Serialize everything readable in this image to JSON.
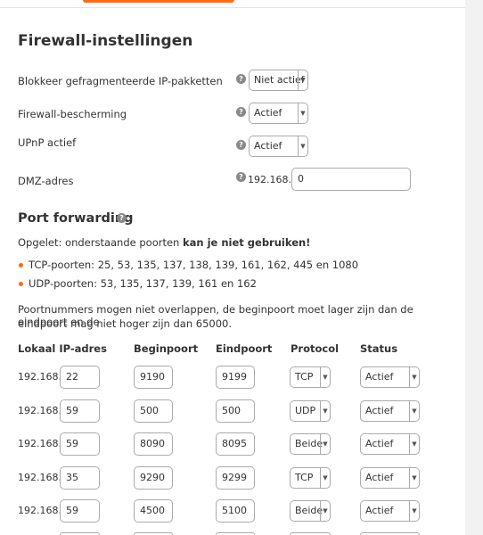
{
  "section_title": "Firewall-instellingen",
  "settings": {
    "fragmented": {
      "label": "Blokkeer gefragmenteerde IP-pakketten",
      "value": "Niet actief"
    },
    "protection": {
      "label": "Firewall-bescherming",
      "value": "Actief"
    },
    "upnp": {
      "label": "UPnP actief",
      "value": "Actief"
    },
    "dmz": {
      "label": "DMZ-adres",
      "prefix": "192.168.0.",
      "value": "0"
    }
  },
  "help_glyph": "?",
  "port_forwarding": {
    "title": "Port forwarding",
    "warning_prefix": "Opgelet: onderstaande poorten ",
    "warning_bold": "kan je niet gebruiken!",
    "tcp_ports": "TCP-poorten: 25, 53, 135, 137, 138, 139, 161, 162, 445 en 1080",
    "udp_ports": "UDP-poorten: 53, 135, 137, 139, 161 en 162",
    "note_line1": "Poortnummers mogen niet overlappen, de beginpoort moet lager zijn dan de eindpoort en de",
    "note_line2": "eindpoort mag niet hoger zijn dan 65000.",
    "columns": [
      "Lokaal IP-adres",
      "Beginpoort",
      "Eindpoort",
      "Protocol",
      "Status"
    ],
    "ip_prefix": "192.168.0.",
    "rows": [
      {
        "ip": "22",
        "start": "9190",
        "end": "9199",
        "protocol": "TCP",
        "status": "Actief"
      },
      {
        "ip": "59",
        "start": "500",
        "end": "500",
        "protocol": "UDP",
        "status": "Actief"
      },
      {
        "ip": "59",
        "start": "8090",
        "end": "8095",
        "protocol": "Beide",
        "status": "Actief"
      },
      {
        "ip": "35",
        "start": "9290",
        "end": "9299",
        "protocol": "TCP",
        "status": "Actief"
      },
      {
        "ip": "59",
        "start": "4500",
        "end": "5100",
        "protocol": "Beide",
        "status": "Actief"
      }
    ]
  },
  "colors": {
    "accent": "#ff6a13",
    "text": "#333333",
    "border": "#aaaaaa"
  },
  "icons": {
    "dropdown": "chevron-down-icon",
    "help": "help-icon"
  }
}
